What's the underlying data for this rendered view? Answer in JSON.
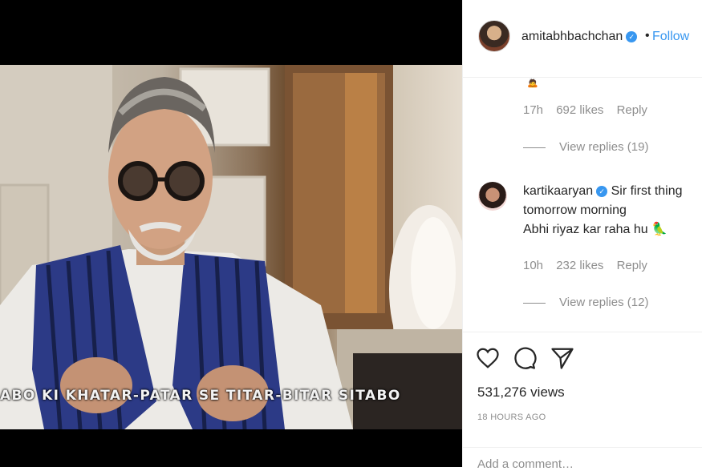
{
  "video": {
    "subtitle": "ABO KI KHATAR-PATAR SE TITAR-BITAR SITABO"
  },
  "header": {
    "username": "amitabhbachchan",
    "separator": "•",
    "follow_label": "Follow"
  },
  "comments": [
    {
      "emoji": "🙇",
      "time": "17h",
      "likes": "692 likes",
      "reply_label": "Reply",
      "view_replies": "View replies (19)"
    },
    {
      "username": "kartikaaryan",
      "text_line1": "Sir first thing",
      "text_line2": "tomorrow morning",
      "text_line3": "Abhi riyaz kar raha hu 🦜",
      "time": "10h",
      "likes": "232 likes",
      "reply_label": "Reply",
      "view_replies": "View replies (12)"
    }
  ],
  "actions": {
    "like_icon": "heart-icon",
    "comment_icon": "comment-icon",
    "share_icon": "paper-plane-icon",
    "views": "531,276 views",
    "posted": "18 HOURS AGO"
  },
  "add_comment": {
    "placeholder": "Add a comment…"
  },
  "colors": {
    "accent": "#3897f0",
    "muted": "#8e8e8e",
    "text": "#262626"
  }
}
